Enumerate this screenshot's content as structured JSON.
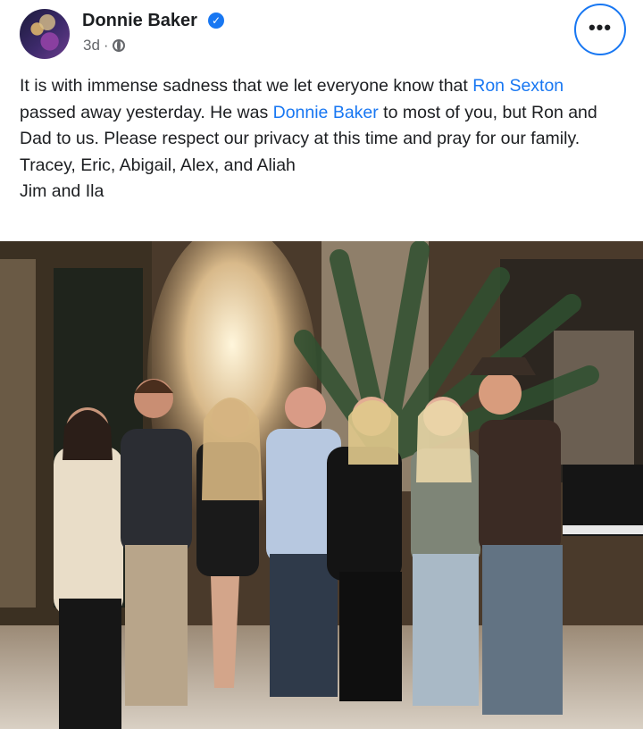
{
  "post": {
    "author": "Donnie Baker",
    "time": "3d",
    "separator": "·",
    "verified_symbol": "✓",
    "more_symbol": "•••",
    "body": {
      "p1_text1": "It is with immense sadness that we let everyone know that ",
      "mention1": "Ron Sexton",
      "p1_text2": " passed away yesterday. He was ",
      "mention2": "Donnie Baker",
      "p1_text3": " to most of you, but Ron and Dad to us. Please respect our privacy at this time and pray for our family.",
      "line2": "Tracey, Eric, Abigail, Alex, and Aliah",
      "line3": "Jim and Ila"
    },
    "link_color": "#1877f2"
  },
  "photo": {
    "description_icon": "group-photo-image",
    "people": 7
  }
}
